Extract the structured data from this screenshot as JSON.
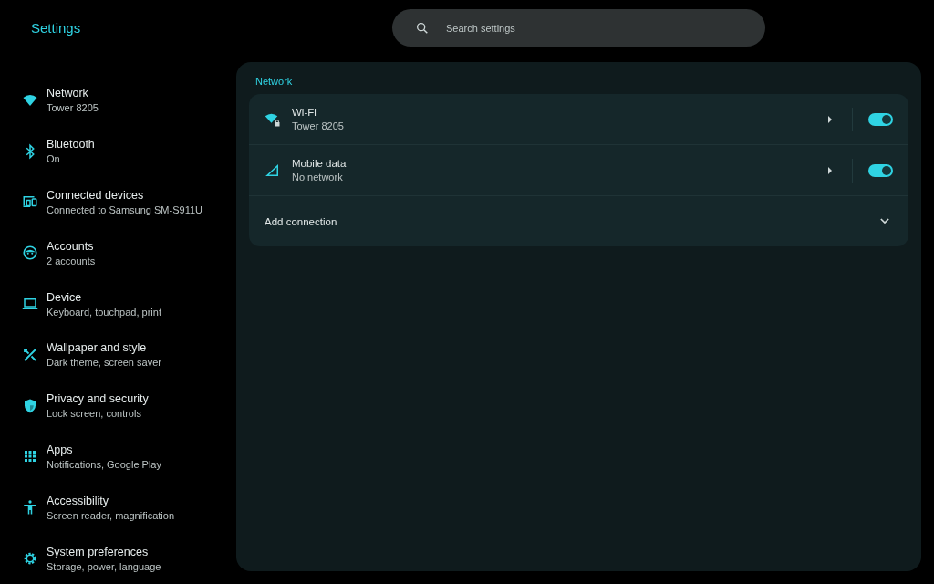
{
  "app_title": "Settings",
  "search": {
    "placeholder": "Search settings"
  },
  "sidebar": {
    "items": [
      {
        "title": "Network",
        "subtitle": "Tower 8205"
      },
      {
        "title": "Bluetooth",
        "subtitle": "On"
      },
      {
        "title": "Connected devices",
        "subtitle": "Connected to Samsung SM-S911U"
      },
      {
        "title": "Accounts",
        "subtitle": "2 accounts"
      },
      {
        "title": "Device",
        "subtitle": "Keyboard, touchpad, print"
      },
      {
        "title": "Wallpaper and style",
        "subtitle": "Dark theme, screen saver"
      },
      {
        "title": "Privacy and security",
        "subtitle": "Lock screen, controls"
      },
      {
        "title": "Apps",
        "subtitle": "Notifications, Google Play"
      },
      {
        "title": "Accessibility",
        "subtitle": "Screen reader, magnification"
      },
      {
        "title": "System preferences",
        "subtitle": "Storage, power, language"
      }
    ]
  },
  "section": {
    "heading": "Network",
    "rows": [
      {
        "kind": "toggle",
        "title": "Wi-Fi",
        "subtitle": "Tower 8205",
        "on": true
      },
      {
        "kind": "toggle",
        "title": "Mobile data",
        "subtitle": "No network",
        "on": true
      },
      {
        "kind": "expand",
        "title": "Add connection",
        "expanded": false
      }
    ]
  }
}
